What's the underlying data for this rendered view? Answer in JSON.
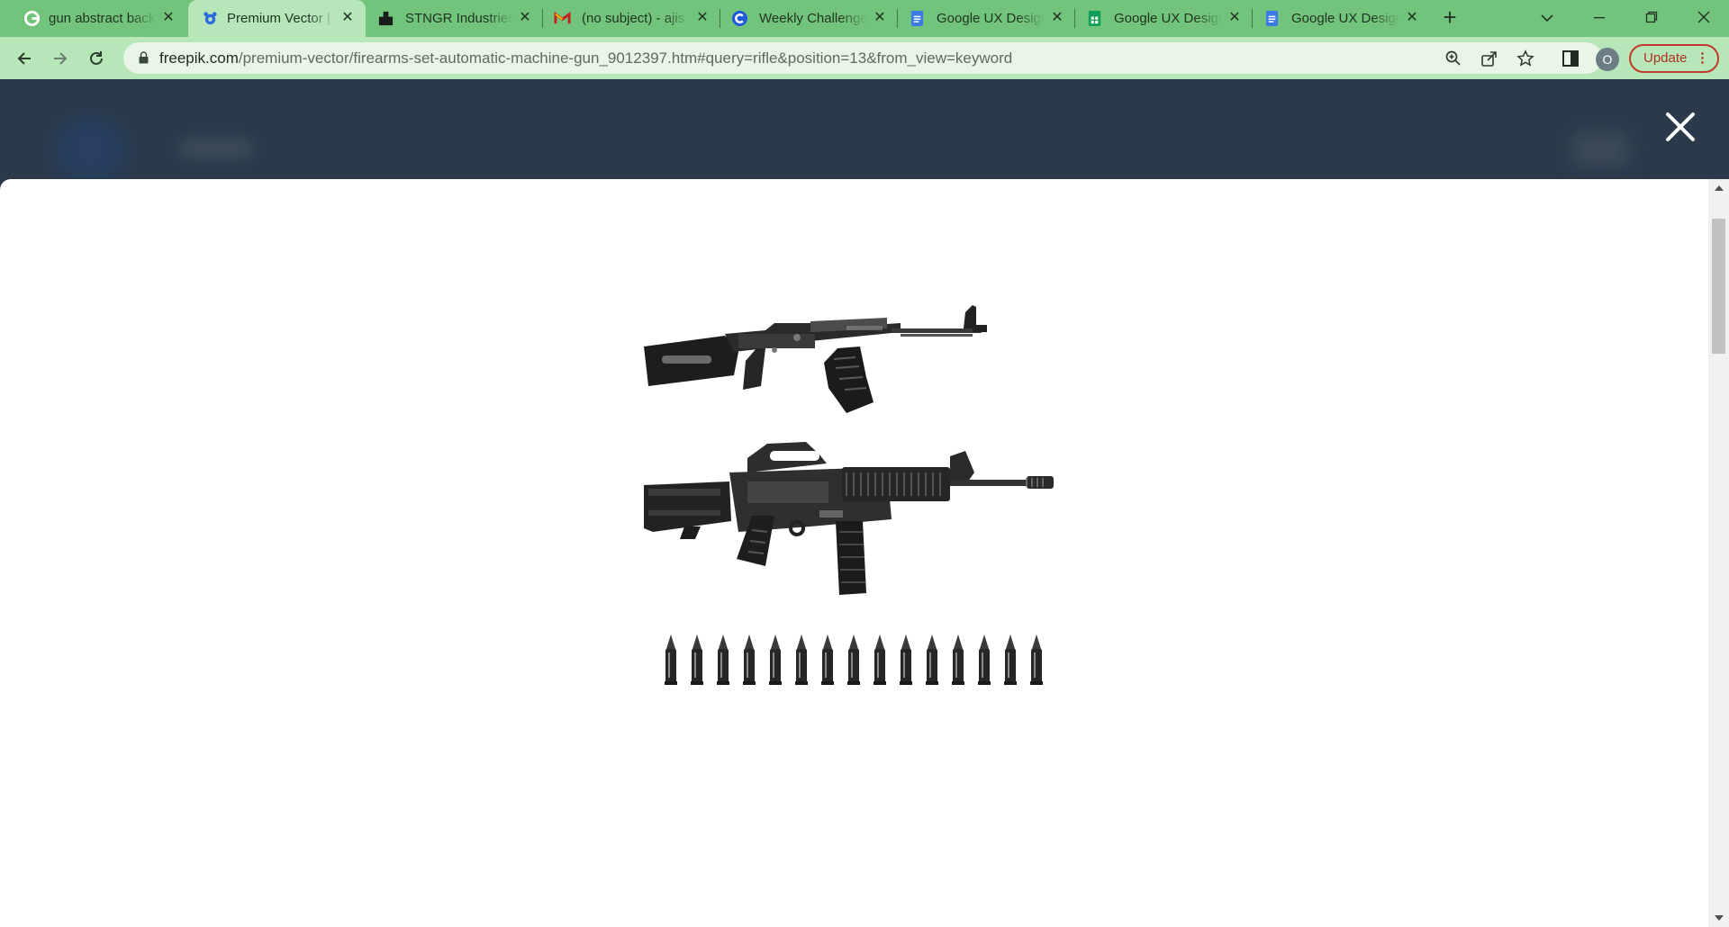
{
  "tabs": [
    {
      "title": "gun abstract back",
      "icon": "google-icon",
      "active": false
    },
    {
      "title": "Premium Vector | F",
      "icon": "freepik-icon",
      "active": true
    },
    {
      "title": "STNGR Industries",
      "icon": "stngr-icon",
      "active": false
    },
    {
      "title": "(no subject) - ajis",
      "icon": "gmail-icon",
      "active": false
    },
    {
      "title": "Weekly Challenge",
      "icon": "coursera-icon",
      "active": false
    },
    {
      "title": "Google UX Design",
      "icon": "google-docs-icon",
      "active": false
    },
    {
      "title": "Google UX Design",
      "icon": "google-sheets-icon",
      "active": false
    },
    {
      "title": "Google UX Design",
      "icon": "google-docs-icon",
      "active": false
    }
  ],
  "address_bar": {
    "host": "freepik.com",
    "path": "/premium-vector/firearms-set-automatic-machine-gun_9012397.htm#query=rifle&position=13&from_view=keyword"
  },
  "profile": {
    "initial": "O"
  },
  "update_button": {
    "label": "Update",
    "menu": "⋮"
  },
  "colors": {
    "tab_strip": "#72c47c",
    "toolbar": "#b7e6b9",
    "page_overlay": "#2b3a4a",
    "update_accent": "#c0392b"
  },
  "icons": {
    "back": "arrow-left-icon",
    "forward": "arrow-right-icon",
    "reload": "reload-icon",
    "zoom": "zoom-icon",
    "share": "share-icon",
    "bookmark": "star-icon",
    "side_panel": "side-panel-icon",
    "close_modal": "close-icon"
  },
  "preview": {
    "image": "firearms-set-illustration",
    "items": [
      "ak-rifle",
      "m16-rifle",
      "bullets-row"
    ],
    "bullet_count": 15
  }
}
